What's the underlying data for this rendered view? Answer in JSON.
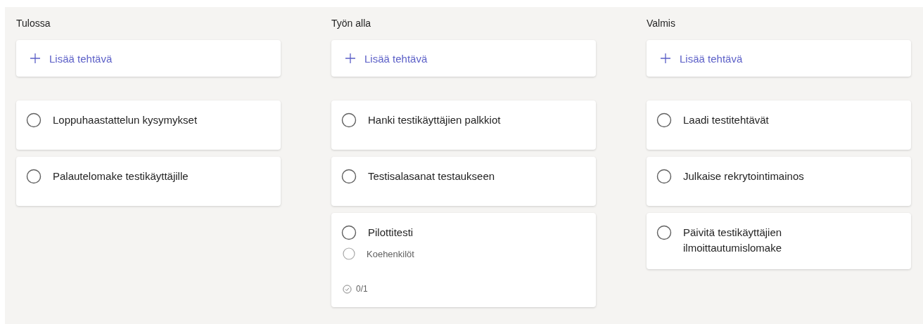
{
  "columns": [
    {
      "title": "Tulossa",
      "add_label": "Lisää tehtävä",
      "tasks": [
        {
          "title": "Loppuhaastattelun kysymykset",
          "completed": false
        },
        {
          "title": "Palautelomake testikäyttäjille",
          "completed": false
        }
      ]
    },
    {
      "title": "Työn alla",
      "add_label": "Lisää tehtävä",
      "tasks": [
        {
          "title": "Hanki testikäyttäjien palkkiot",
          "completed": false
        },
        {
          "title": "Testisalasanat testaukseen",
          "completed": false
        },
        {
          "title": "Pilottitesti",
          "completed": false,
          "checklist": [
            {
              "title": "Koehenkilöt",
              "completed": false
            }
          ],
          "progress": "0/1"
        }
      ]
    },
    {
      "title": "Valmis",
      "add_label": "Lisää tehtävä",
      "tasks": [
        {
          "title": "Laadi testitehtävät",
          "completed": false
        },
        {
          "title": "Julkaise rekrytointimainos",
          "completed": false
        },
        {
          "title": "Päivitä testikäyttäjien ilmoittautumislomake",
          "completed": false
        }
      ]
    }
  ]
}
